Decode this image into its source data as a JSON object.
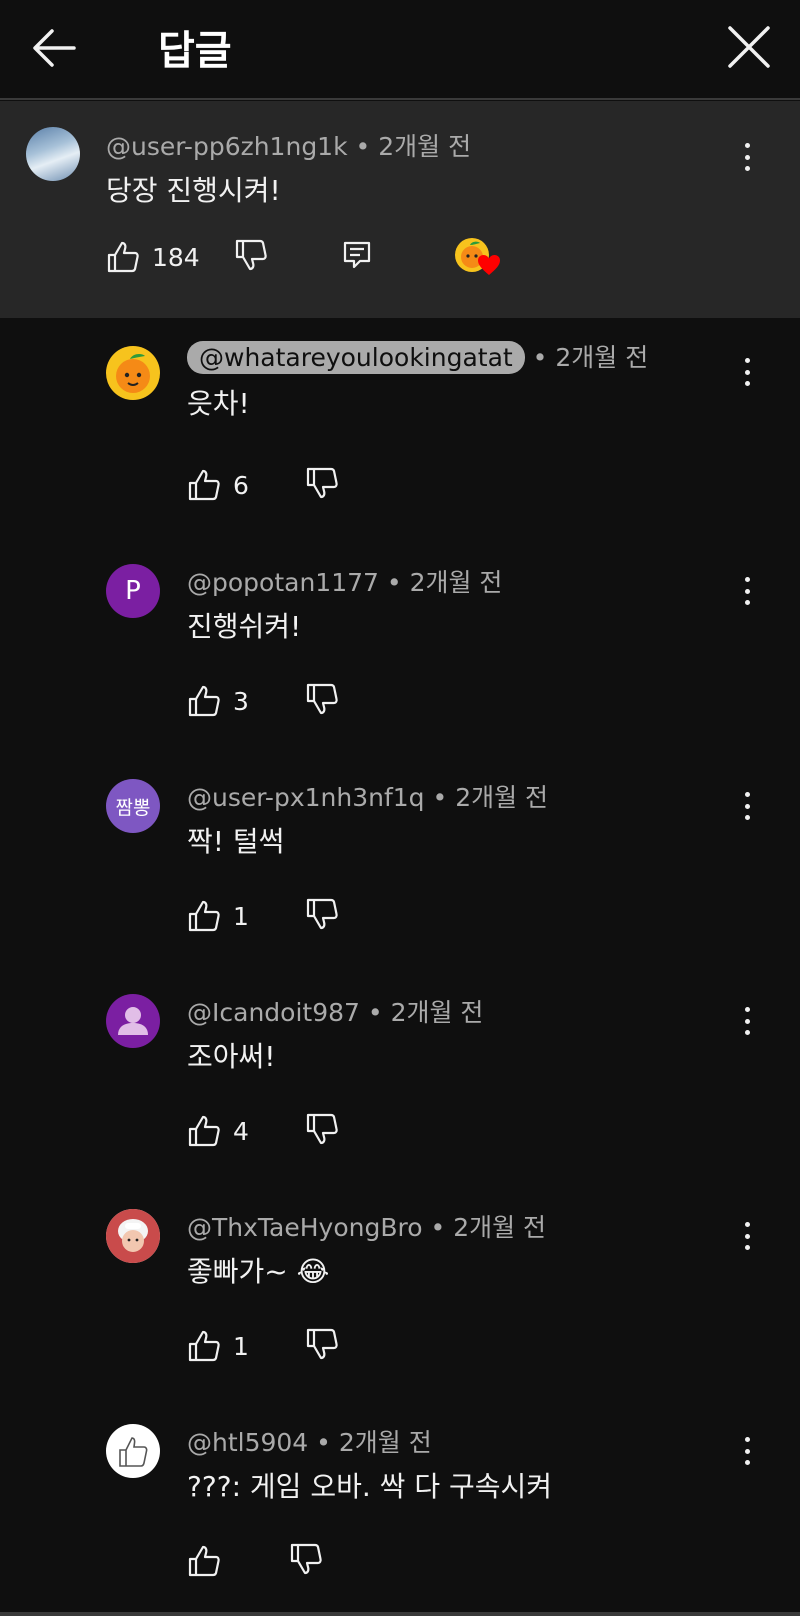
{
  "header": {
    "title": "답글"
  },
  "pinned": {
    "handle": "@user-pp6zh1ng1k",
    "time": "2개월 전",
    "text": "당장 진행시켜!",
    "likes": "184",
    "heart_by_creator": true
  },
  "replies": [
    {
      "handle": "@whatareyoulookingatat",
      "time": "2개월 전",
      "text": "읏차!",
      "likes": "6",
      "avatar": "orange-avatar"
    },
    {
      "handle": "@popotan1177",
      "time": "2개월 전",
      "text": "진행쉬켜!",
      "likes": "3",
      "avatar_letter": "P",
      "avatar_color": "#7b1fa2"
    },
    {
      "handle": "@user-px1nh3nf1q",
      "time": "2개월 전",
      "text": "짝! 털썩",
      "likes": "1",
      "avatar_letter": "짬뽕",
      "avatar_color": "#7e57c2"
    },
    {
      "handle": "@Icandoit987",
      "time": "2개월 전",
      "text": "조아써!",
      "likes": "4",
      "avatar_color": "#7b1fa2"
    },
    {
      "handle": "@ThxTaeHyongBro",
      "time": "2개월 전",
      "text": "좋빠가~ 😂",
      "likes": "1",
      "avatar": "photo-avatar"
    },
    {
      "handle": "@htl5904",
      "time": "2개월 전",
      "text": "???: 게임 오바. 싹 다 구속시켜",
      "likes": "",
      "avatar": "thumb-avatar"
    }
  ],
  "separator": "•",
  "colors": {
    "background": "#0f0f0f",
    "pinned_bg": "#272727",
    "meta": "#aaaaaa",
    "text": "#f1f1f1"
  }
}
